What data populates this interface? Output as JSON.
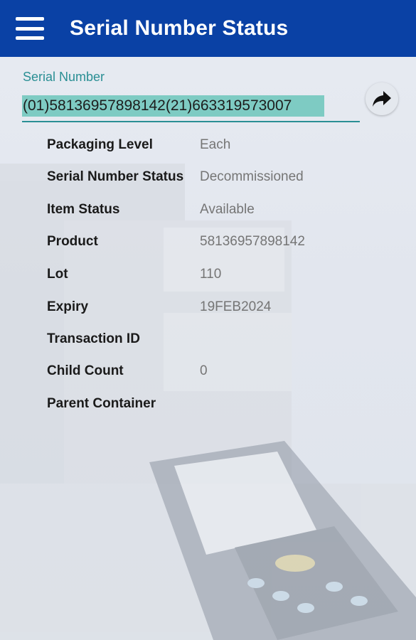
{
  "appbar": {
    "title": "Serial Number Status",
    "menu_icon": "hamburger-menu-icon",
    "color": "#0a41a5"
  },
  "serial": {
    "label": "Serial Number",
    "value": "(01)58136957898142(21)663319573007",
    "submit_icon": "forward-arrow-icon",
    "accent": "#2a8f94",
    "highlight": "#7ecbc3"
  },
  "details": [
    {
      "label": "Packaging Level",
      "value": "Each"
    },
    {
      "label": "Serial Number Status",
      "value": "Decommissioned"
    },
    {
      "label": "Item Status",
      "value": "Available"
    },
    {
      "label": "Product",
      "value": "58136957898142"
    },
    {
      "label": "Lot",
      "value": "110"
    },
    {
      "label": "Expiry",
      "value": "19FEB2024"
    },
    {
      "label": "Transaction ID",
      "value": ""
    },
    {
      "label": "Child Count",
      "value": "0"
    },
    {
      "label": "Parent Container",
      "value": ""
    }
  ]
}
